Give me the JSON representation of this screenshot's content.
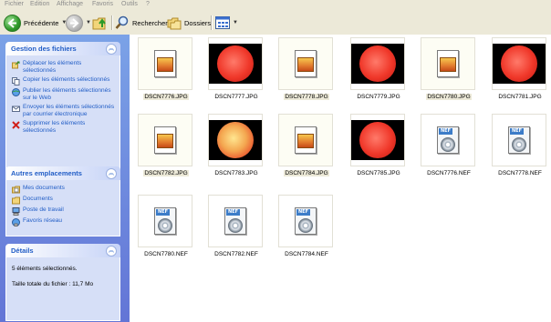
{
  "menubar": [
    "Fichier",
    "Edition",
    "Affichage",
    "Favoris",
    "Outils",
    "?"
  ],
  "toolbar": {
    "back_label": "Précédente",
    "search_label": "Rechercher",
    "folders_label": "Dossiers"
  },
  "tasks_panel": {
    "title": "Gestion des fichiers",
    "items": [
      {
        "icon": "move-icon",
        "label": "Déplacer les éléments sélectionnés"
      },
      {
        "icon": "copy-icon",
        "label": "Copier les éléments sélectionnés"
      },
      {
        "icon": "publish-web-icon",
        "label": "Publier les éléments sélectionnés sur le Web"
      },
      {
        "icon": "email-icon",
        "label": "Envoyer les éléments sélectionnés par courrier électronique"
      },
      {
        "icon": "delete-icon",
        "label": "Supprimer les éléments sélectionnés"
      }
    ]
  },
  "places_panel": {
    "title": "Autres emplacements",
    "items": [
      {
        "icon": "my-documents-icon",
        "label": "Mes documents"
      },
      {
        "icon": "documents-folder-icon",
        "label": "Documents"
      },
      {
        "icon": "my-computer-icon",
        "label": "Poste de travail"
      },
      {
        "icon": "network-icon",
        "label": "Favoris réseau"
      }
    ]
  },
  "details_panel": {
    "title": "Détails",
    "line1": "5 éléments sélectionnés.",
    "line2": "Taille totale du fichier : 11,7 Mo"
  },
  "files": [
    {
      "name": "DSCN7776.JPG",
      "kind": "doc",
      "selected": true
    },
    {
      "name": "DSCN7777.JPG",
      "kind": "sun",
      "selected": false
    },
    {
      "name": "DSCN7778.JPG",
      "kind": "doc",
      "selected": true
    },
    {
      "name": "DSCN7779.JPG",
      "kind": "sun",
      "selected": false
    },
    {
      "name": "DSCN7780.JPG",
      "kind": "doc",
      "selected": true
    },
    {
      "name": "DSCN7781.JPG",
      "kind": "sun",
      "selected": false
    },
    {
      "name": "DSCN7782.JPG",
      "kind": "doc",
      "selected": true
    },
    {
      "name": "DSCN7783.JPG",
      "kind": "sun-light",
      "selected": false
    },
    {
      "name": "DSCN7784.JPG",
      "kind": "doc",
      "selected": true
    },
    {
      "name": "DSCN7785.JPG",
      "kind": "sun",
      "selected": false
    },
    {
      "name": "DSCN7776.NEF",
      "kind": "nef",
      "selected": false
    },
    {
      "name": "DSCN7778.NEF",
      "kind": "nef",
      "selected": false
    },
    {
      "name": "DSCN7780.NEF",
      "kind": "nef",
      "selected": false
    },
    {
      "name": "DSCN7782.NEF",
      "kind": "nef",
      "selected": false
    },
    {
      "name": "DSCN7784.NEF",
      "kind": "nef",
      "selected": false
    }
  ],
  "nef_tag": "NEF",
  "colors": {
    "task_link": "#215dc6",
    "left_pane_top": "#7ba2e7",
    "left_pane_bottom": "#6375d6",
    "selection_bg": "#ece9d8"
  }
}
